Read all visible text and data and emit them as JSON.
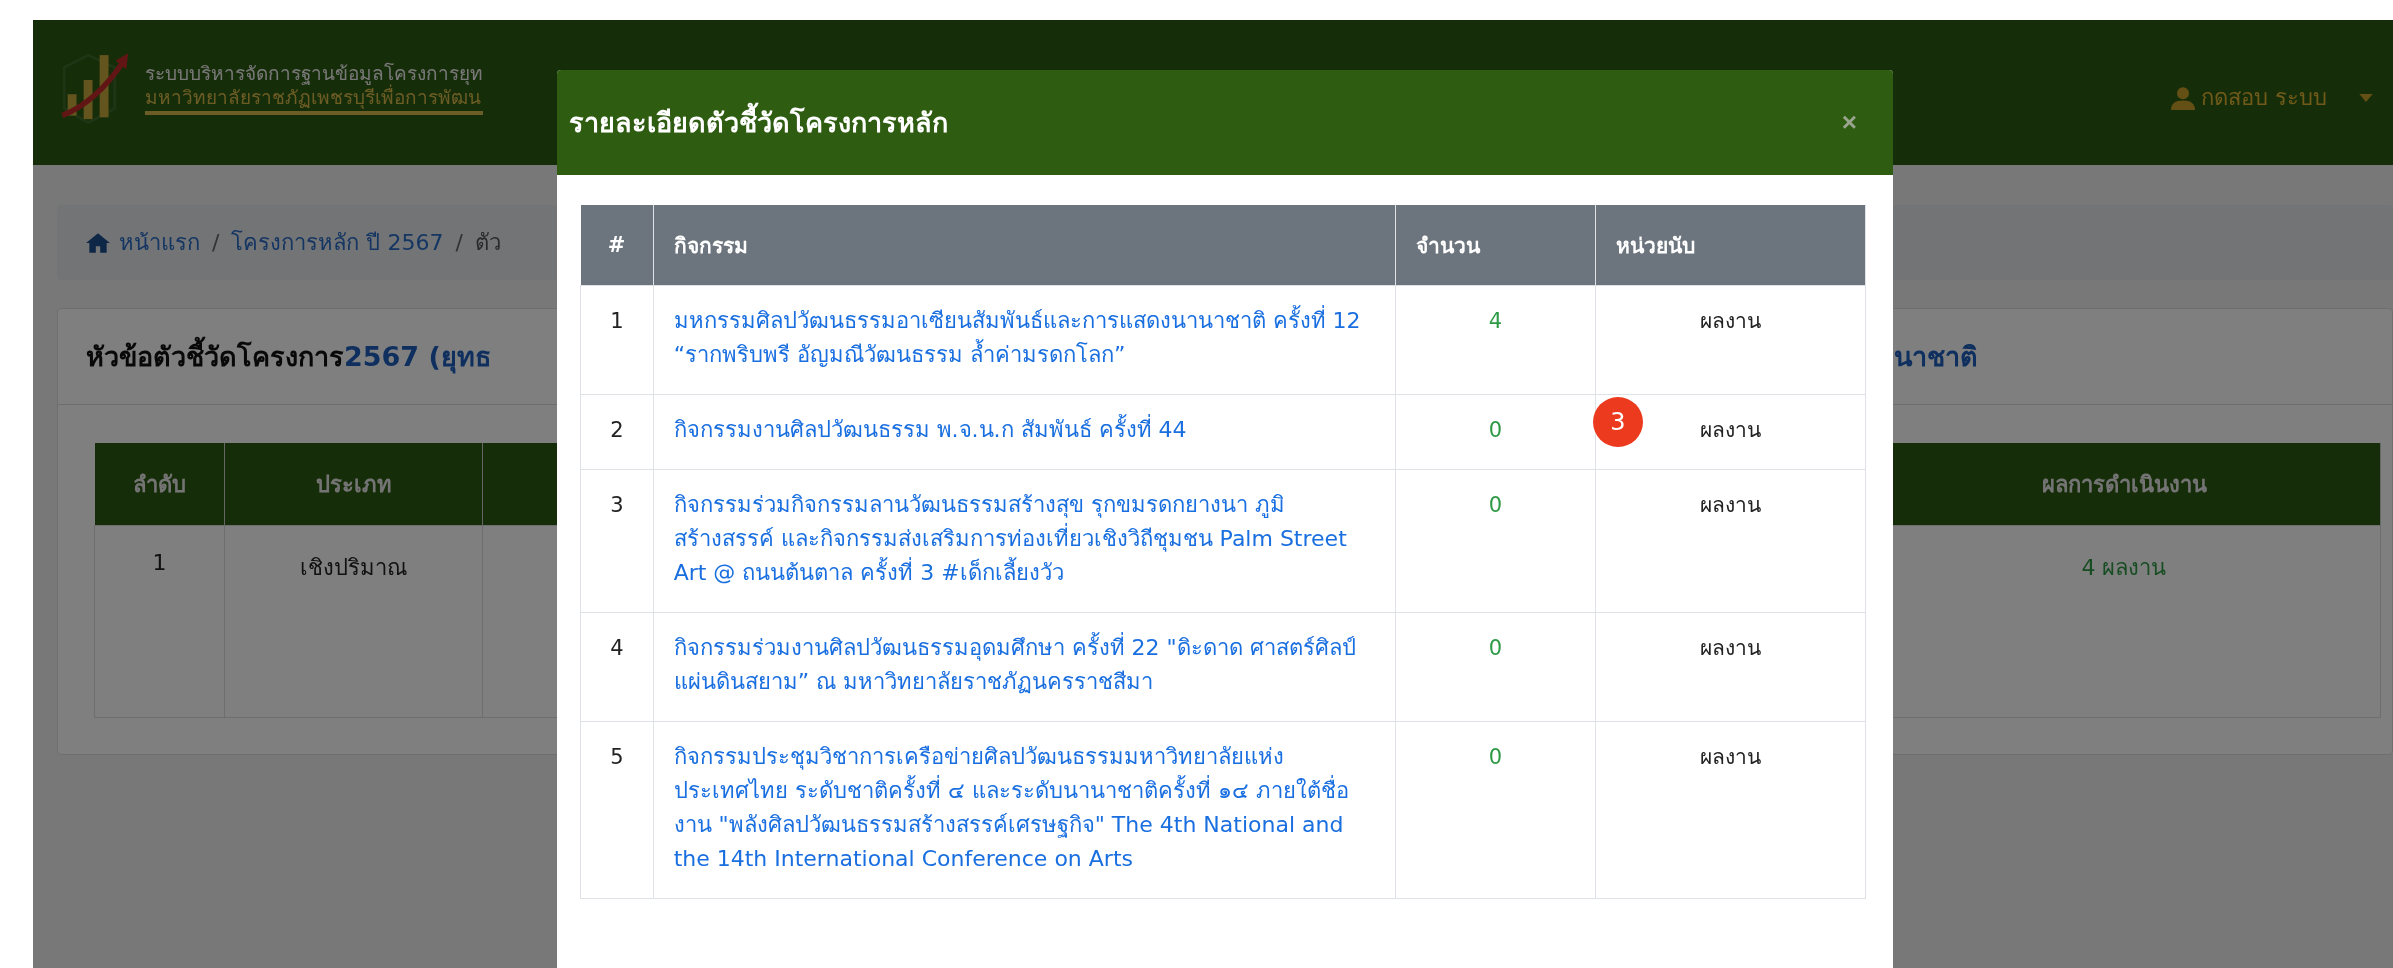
{
  "header": {
    "title_line1": "ระบบบริหารจัดการฐานข้อมูลโครงการยุท",
    "title_line2": "มหาวิทยาลัยราชภัฏเพชรบุรีเพื่อการพัฒน",
    "user": "กดสอบ ระบบ"
  },
  "breadcrumb": [
    {
      "kind": "home",
      "label": "หน้าแรก"
    },
    {
      "separator": "/",
      "label": "โครงการหลัก ปี 2567"
    },
    {
      "separator": "/",
      "label": "ตัว"
    }
  ],
  "card": {
    "title_left": "หัวข้อตัวชี้วัดโครงการ",
    "title_year": "2567 (ยุทธ",
    "title_right": "นาชาติ"
  },
  "table": {
    "columns_left": [
      "ลำดับ",
      "ประเภท"
    ],
    "column_right": "ผลการดำเนินงาน",
    "rows": [
      {
        "order": "1",
        "type": "เชิงปริมาณ",
        "result": "4 ผลงาน"
      }
    ]
  },
  "modal": {
    "title": "รายละเอียดตัวชี้วัดโครงการหลัก",
    "close": "×",
    "columns": [
      "#",
      "กิจกรรม",
      "จำนวน",
      "หน่วยนับ"
    ],
    "rows": [
      {
        "no": "1",
        "activity": "มหกรรมศิลปวัฒนธรรมอาเซียนสัมพันธ์และการแสดงนานาชาติ ครั้งที่ 12 “รากพริบพรี อัญมณีวัฒนธรรม ล้ำค่ามรดกโลก”",
        "count": "4",
        "unit": "ผลงาน"
      },
      {
        "no": "2",
        "activity": "กิจกรรมงานศิลปวัฒนธรรม พ.จ.น.ก สัมพันธ์ ครั้งที่ 44",
        "count": "0",
        "unit": "ผลงาน"
      },
      {
        "no": "3",
        "activity": "กิจกรรมร่วมกิจกรรมลานวัฒนธรรมสร้างสุข รุกขมรดกยางนา ภูมิสร้างสรรค์ และกิจกรรมส่งเสริมการท่องเที่ยวเชิงวิถีชุมชน Palm Street Art @ ถนนต้นตาล ครั้งที่ 3 #เด็กเลี้ยงวัว",
        "count": "0",
        "unit": "ผลงาน"
      },
      {
        "no": "4",
        "activity": "กิจกรรมร่วมงานศิลปวัฒนธรรมอุดมศึกษา ครั้งที่ 22 \"ดิะดาด ศาสตร์ศิลป์ แผ่นดินสยาม” ณ มหาวิทยาลัยราชภัฏนครราชสีมา",
        "count": "0",
        "unit": "ผลงาน"
      },
      {
        "no": "5",
        "activity": "กิจกรรมประชุมวิชาการเครือข่ายศิลปวัฒนธรรมมหาวิทยาลัยแห่งประเทศไทย ระดับชาติครั้งที่ ๔ และระดับนานาชาติครั้งที่ ๑๔ ภายใต้ชื่องาน \"พลังศิลปวัฒนธรรมสร้างสรรค์เศรษฐกิจ\" The 4th National and the 14th International Conference on Arts",
        "count": "0",
        "unit": "ผลงาน"
      }
    ]
  },
  "annotation_badge": "3"
}
